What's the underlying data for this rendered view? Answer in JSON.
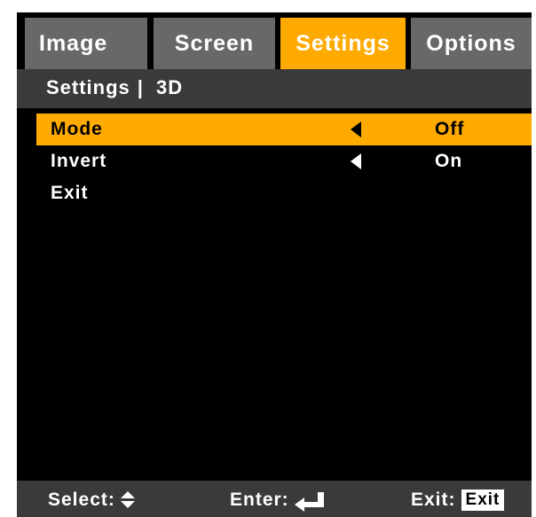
{
  "tabs": [
    {
      "label": "Image",
      "active": false
    },
    {
      "label": "Screen",
      "active": false
    },
    {
      "label": "Settings",
      "active": true
    },
    {
      "label": "Options",
      "active": false
    }
  ],
  "breadcrumb": {
    "section": "Settings",
    "separator": "|",
    "page": "3D"
  },
  "menu": [
    {
      "label": "Mode",
      "value": "Off",
      "selected": true,
      "left_arrow": true,
      "right_arrow": true
    },
    {
      "label": "Invert",
      "value": "On",
      "selected": false,
      "left_arrow": true,
      "right_arrow": true
    },
    {
      "label": "Exit",
      "value": "",
      "selected": false,
      "left_arrow": false,
      "right_arrow": true
    }
  ],
  "footer": {
    "select_label": "Select:",
    "enter_label": "Enter:",
    "exit_label": "Exit:",
    "exit_key": "Exit"
  },
  "colors": {
    "accent": "#ffaa00",
    "tab_inactive": "#686868",
    "bar": "#3a3a3a",
    "background": "#000000"
  },
  "icons": {
    "select": "up-down-arrows-icon",
    "enter": "enter-return-icon",
    "menu_left": "left-triangle-icon",
    "menu_right": "right-triangle-icon"
  }
}
